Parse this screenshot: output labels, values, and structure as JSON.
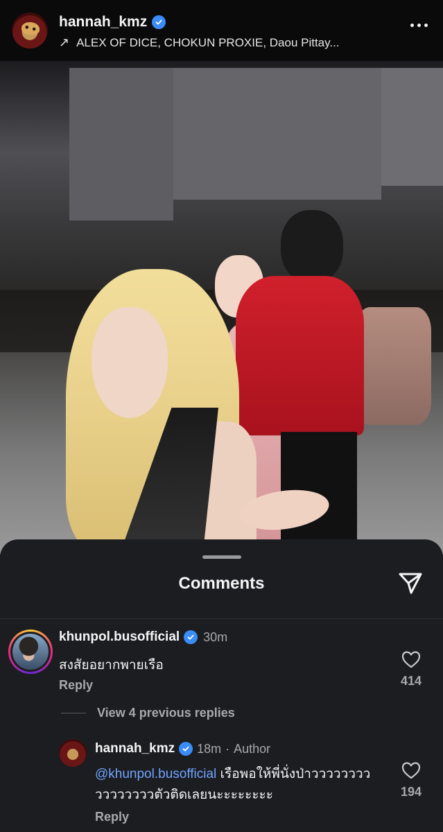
{
  "post": {
    "username": "hannah_kmz",
    "collab_arrow": "↗",
    "collaborators": "ALEX OF DICE, CHOKUN PROXIE, Daou Pittay..."
  },
  "comments_sheet": {
    "title": "Comments"
  },
  "comments": [
    {
      "username": "khunpol.busofficial",
      "time": "30m",
      "text": "สงสัยอยากพายเรือ",
      "reply_label": "Reply",
      "likes": "414"
    }
  ],
  "view_previous_replies": "View 4 previous replies",
  "reply": {
    "username": "hannah_kmz",
    "time": "18m",
    "separator": "·",
    "author_label": "Author",
    "mention": "@khunpol.busofficial",
    "text": " เรือพอให้พี่นั่งป่าววววววววววววววววตัวติดเลยนะะะะะะะะ",
    "reply_label": "Reply",
    "likes": "194"
  },
  "colors": {
    "sheet_background": "#1c1d21",
    "verified_badge": "#3b8cf6",
    "mention_link": "#6fa5ff",
    "secondary_text": "#a8a8ad"
  },
  "icons": {
    "verified": "verified-badge-icon",
    "more": "more-options-icon",
    "send": "send-paper-plane-icon",
    "like": "heart-icon",
    "collab": "arrow-up-right-icon"
  }
}
